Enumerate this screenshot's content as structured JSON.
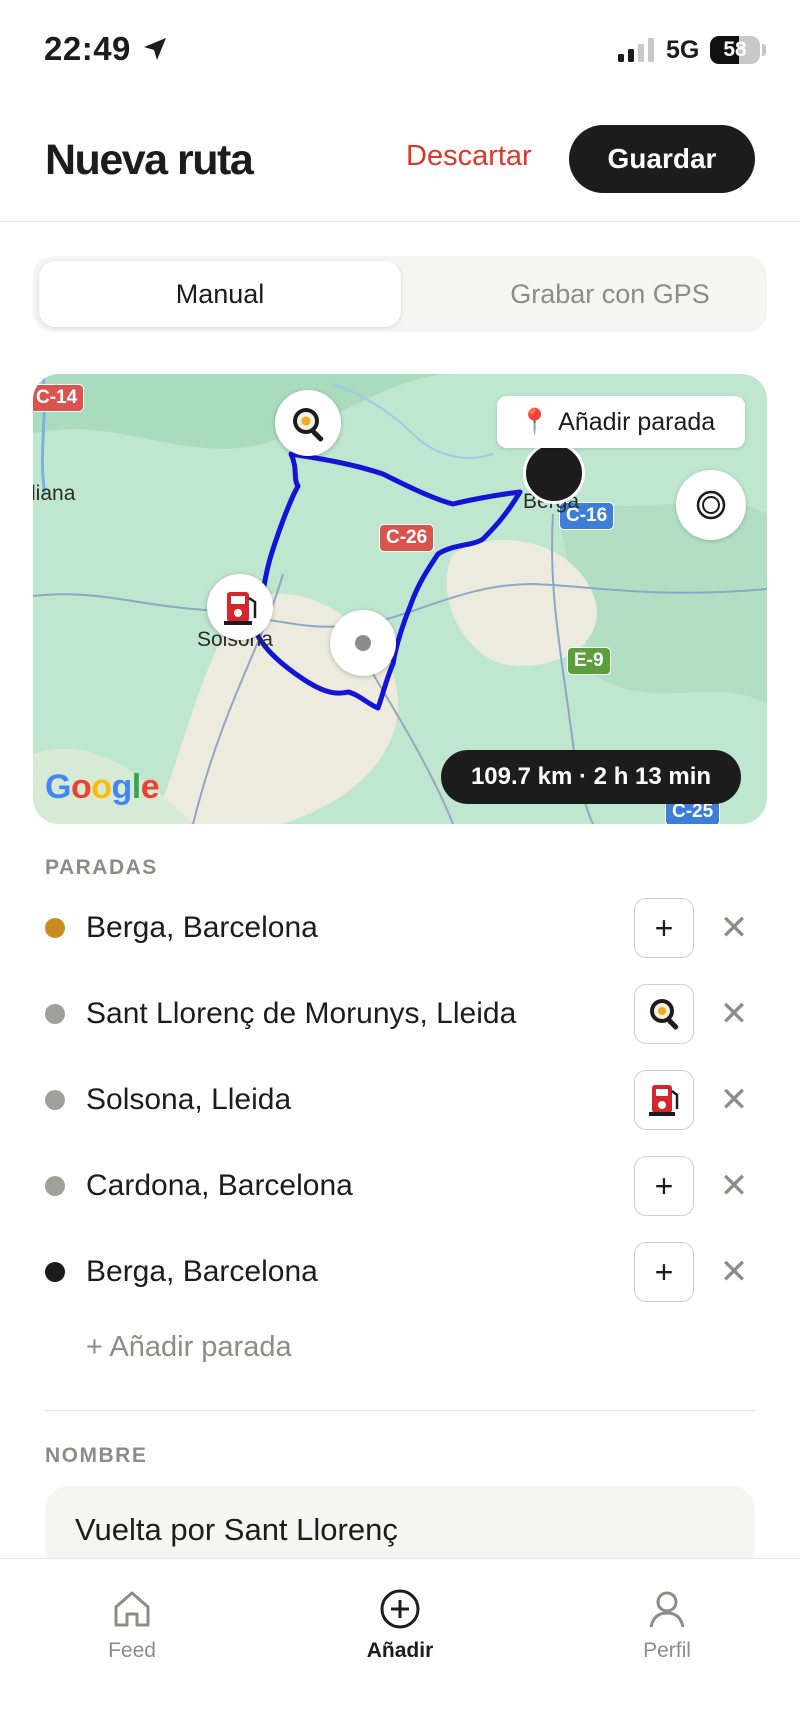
{
  "status_bar": {
    "time": "22:49",
    "network": "5G",
    "battery": "58",
    "battery_level": 0.58
  },
  "header": {
    "title": "Nueva ruta",
    "discard_label": "Descartar",
    "save_label": "Guardar"
  },
  "mode_tabs": {
    "manual": "Manual",
    "gps": "Grabar con GPS",
    "selected": "Manual"
  },
  "map": {
    "add_stop_label": "Añadir parada",
    "distance_label": "109.7 km · 2 h 13 min",
    "provider": "Google",
    "towns": {
      "berga": "Berga",
      "solsona": "Solsona",
      "left": "liana"
    },
    "roads": {
      "c14": "C-14",
      "c26": "C-26",
      "c16": "C-16",
      "e9": "E-9",
      "c25": "C-25"
    },
    "route_color": "#1414d6"
  },
  "stops_section": {
    "label": "PARADAS",
    "items": [
      {
        "name": "Berga, Barcelona",
        "dot_color": "#c98a22",
        "action": "+"
      },
      {
        "name": "Sant Llorenç de Morunys, Lleida",
        "dot_color": "#a0a09b",
        "action": "food-icon"
      },
      {
        "name": "Solsona, Lleida",
        "dot_color": "#a0a09b",
        "action": "fuel-icon"
      },
      {
        "name": "Cardona, Barcelona",
        "dot_color": "#a0a09b",
        "action": "+"
      },
      {
        "name": "Berga, Barcelona",
        "dot_color": "#1c1c1c",
        "action": "+"
      }
    ],
    "remove_symbol": "✕",
    "add_link": "+ Añadir parada"
  },
  "name_section": {
    "label": "NOMBRE",
    "value": "Vuelta por Sant Llorenç"
  },
  "tabbar": {
    "feed": "Feed",
    "add": "Añadir",
    "profile": "Perfil",
    "active": "Añadir"
  }
}
